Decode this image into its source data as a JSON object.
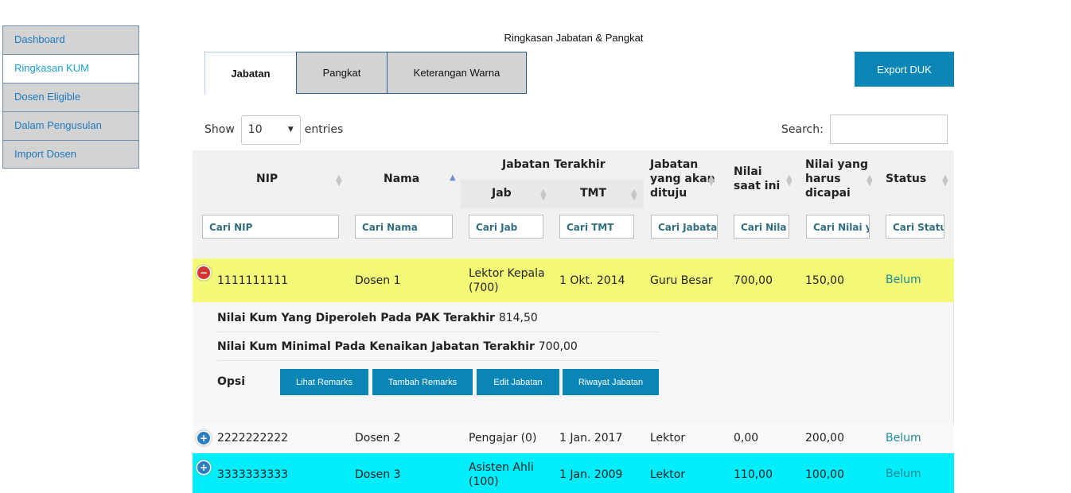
{
  "sidebar": {
    "items": [
      {
        "label": "Dashboard"
      },
      {
        "label": "Ringkasan KUM"
      },
      {
        "label": "Dosen Eligible"
      },
      {
        "label": "Dalam Pengusulan"
      },
      {
        "label": "Import Dosen"
      }
    ],
    "active_index": 1
  },
  "page": {
    "title": "Ringkasan Jabatan & Pangkat"
  },
  "tabs": [
    {
      "label": "Jabatan"
    },
    {
      "label": "Pangkat"
    },
    {
      "label": "Keterangan Warna"
    }
  ],
  "export_button": "Export DUK",
  "length": {
    "show_label": "Show",
    "selected": "10",
    "entries_label": "entries"
  },
  "search": {
    "label": "Search:",
    "value": ""
  },
  "table": {
    "headers": {
      "nip": "NIP",
      "nama": "Nama",
      "jabatan_terakhir": "Jabatan Terakhir",
      "jab": "Jab",
      "tmt": "TMT",
      "jabatan_dituju": [
        "Jabatan",
        "yang akan",
        "dituju"
      ],
      "nilai_saat_ini": [
        "Nilai",
        "saat ini"
      ],
      "nilai_harus": [
        "Nilai yang",
        "harus",
        "dicapai"
      ],
      "status": "Status"
    },
    "filters": {
      "nip": "Cari NIP",
      "nama": "Cari Nama",
      "jab": "Cari Jab",
      "tmt": "Cari TMT",
      "jabatan_dituju": "Cari Jabata",
      "nilai_saat_ini": "Cari Nila",
      "nilai_harus": "Cari Nilai y",
      "status": "Cari Statu"
    },
    "rows": [
      {
        "nip": "1111111111",
        "nama": "Dosen 1",
        "jab": [
          "Lektor Kepala",
          "(700)"
        ],
        "tmt": "1 Okt. 2014",
        "dituju": "Guru Besar",
        "nilai": "700,00",
        "harus": "150,00",
        "status": "Belum",
        "color": "#f4fa78",
        "expanded": true
      },
      {
        "nip": "2222222222",
        "nama": "Dosen 2",
        "jab": [
          "Pengajar (0)"
        ],
        "tmt": "1 Jan. 2017",
        "dituju": "Lektor",
        "nilai": "0,00",
        "harus": "200,00",
        "status": "Belum",
        "color": "#f9f9f9",
        "expanded": false
      },
      {
        "nip": "3333333333",
        "nama": "Dosen 3",
        "jab": [
          "Asisten Ahli",
          "(100)"
        ],
        "tmt": "1 Jan. 2009",
        "dituju": "Lektor",
        "nilai": "110,00",
        "harus": "100,00",
        "status": "Belum",
        "color": "#00eefc",
        "expanded": false
      }
    ],
    "detail": {
      "kum_label": "Nilai Kum Yang Diperoleh Pada PAK Terakhir",
      "kum_value": "814,50",
      "minimal_label": "Nilai Kum Minimal Pada Kenaikan Jabatan Terakhir",
      "minimal_value": "700,00",
      "opsi_label": "Opsi",
      "buttons": [
        "Lihat Remarks",
        "Tambah Remarks",
        "Edit Jabatan",
        "Riwayat Jabatan"
      ]
    }
  },
  "icons": {
    "sort": "sort-icon",
    "sort_asc": "sort-asc-icon",
    "collapse": "minus-circle-icon",
    "expand": "plus-circle-icon",
    "dropdown": "caret-down-icon"
  }
}
